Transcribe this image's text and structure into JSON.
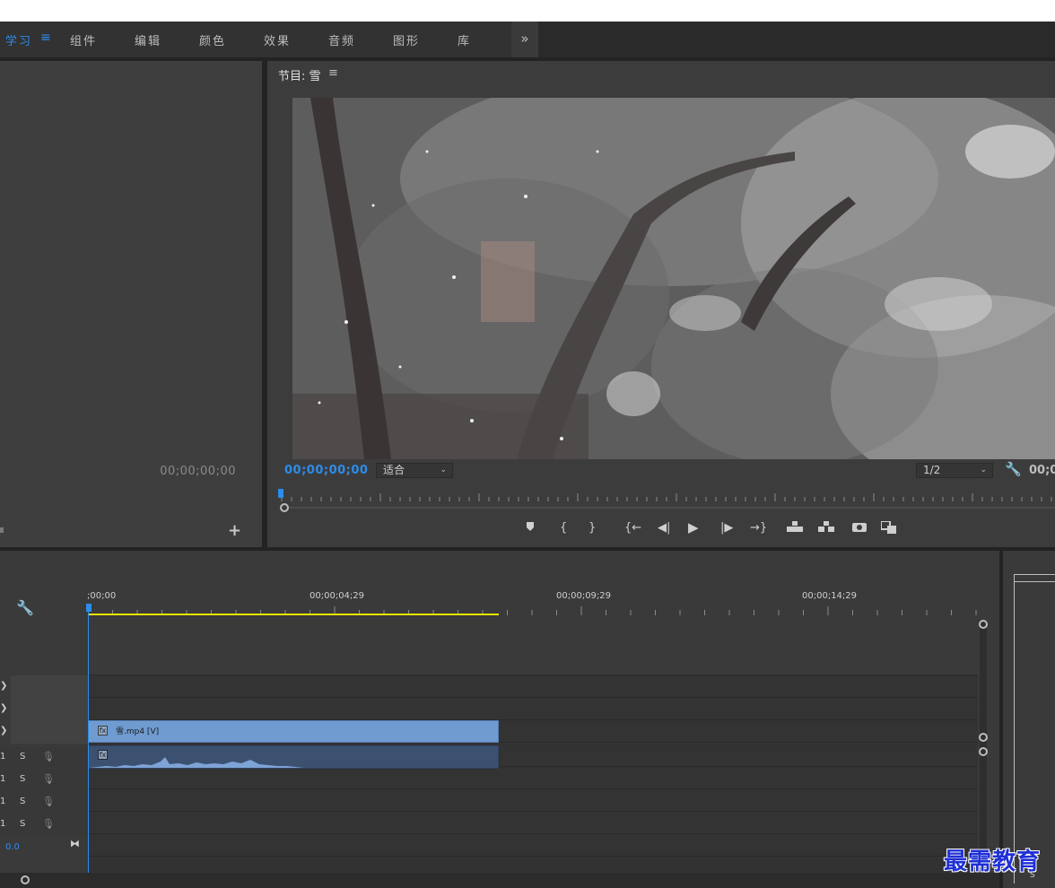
{
  "workspace": {
    "tabs": [
      {
        "label": "学习",
        "active": true
      },
      {
        "label": "组件"
      },
      {
        "label": "编辑"
      },
      {
        "label": "颜色"
      },
      {
        "label": "效果"
      },
      {
        "label": "音频"
      },
      {
        "label": "图形"
      },
      {
        "label": "库"
      }
    ],
    "menu_icon": "≡",
    "more": "»"
  },
  "source": {
    "timecode": "00;00;00;00",
    "add": "+"
  },
  "program": {
    "title": "节目: 雪",
    "menu_icon": "≡",
    "timecode": "00;00;00;00",
    "fit_label": "适合",
    "resolution": "1/2",
    "timecode_end": "00;0",
    "controls": [
      "marker-icon",
      "mark-in-icon",
      "mark-out-icon",
      "go-to-in-icon",
      "step-back-icon",
      "play-icon",
      "step-forward-icon",
      "go-to-out-icon",
      "lift-icon",
      "extract-icon",
      "export-frame-icon",
      "compare-icon"
    ]
  },
  "timeline": {
    "ruler": [
      ";00;00",
      "00;00;04;29",
      "00;00;09;29",
      "00;00;14;29"
    ],
    "video_clip": "雪.mp4 [V]",
    "audio_tracks": [
      {
        "num": "1",
        "solo": "S"
      },
      {
        "num": "1",
        "solo": "S"
      },
      {
        "num": "1",
        "solo": "S"
      },
      {
        "num": "1",
        "solo": "S"
      }
    ],
    "master_level": "0.0"
  },
  "right_panel": {
    "label": "S"
  },
  "watermark": "最需教育",
  "colors": {
    "accent": "#2d8ceb",
    "work_area": "#e8e800",
    "video_clip": "#6f9bd1",
    "audio_clip": "#3c5170"
  }
}
